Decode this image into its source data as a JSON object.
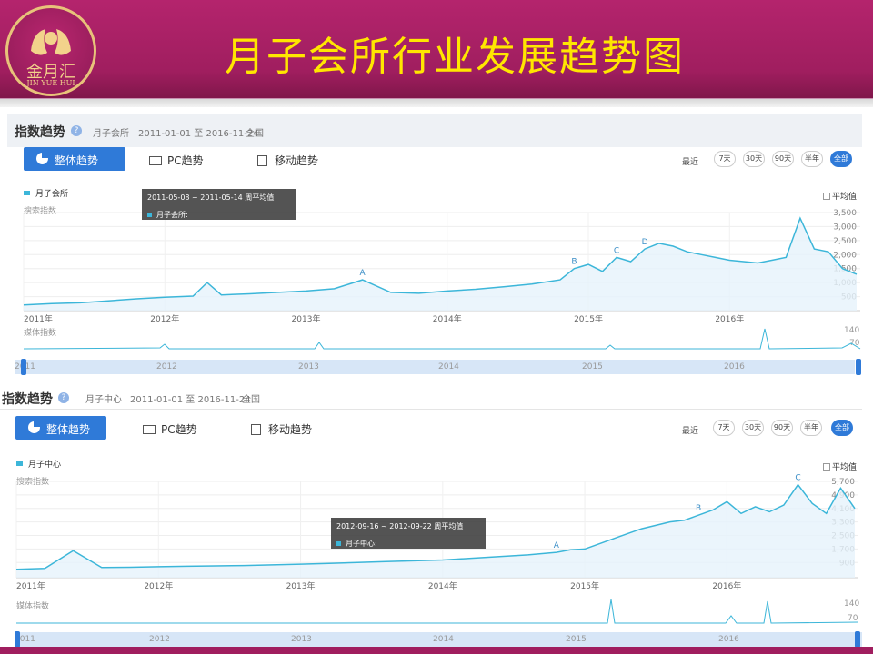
{
  "header": {
    "title": "月子会所行业发展趋势图",
    "logo_text": "金月汇",
    "logo_sub": "JIN YUE HUI"
  },
  "colors": {
    "header": "#a01e5f",
    "title": "#ffe600",
    "line": "#3cb6d9",
    "fill": "#e6f3fb",
    "accent": "#2f7ad8"
  },
  "panels": [
    {
      "section_title": "指数趋势",
      "keyword": "月子会所",
      "date_range": "2011-01-01 至 2016-11-24",
      "region": "全国",
      "tabs": {
        "overall": "整体趋势",
        "pc": "PC趋势",
        "mobile": "移动趋势"
      },
      "range_label": "最近",
      "range_buttons": [
        "7天",
        "30天",
        "90天",
        "半年",
        "全部"
      ],
      "legend": "月子会所",
      "avg_label": "平均值",
      "search_label": "搜索指数",
      "media_label": "媒体指数",
      "tooltip_date": "2011-05-08 ~ 2011-05-14 周平均值",
      "tooltip_series": "月子会所:",
      "media_ticks": [
        "140",
        "70"
      ],
      "slider_years": [
        "2011",
        "2012",
        "2013",
        "2014",
        "2015",
        "2016"
      ]
    },
    {
      "section_title": "指数趋势",
      "keyword": "月子中心",
      "date_range": "2011-01-01 至 2016-11-24",
      "region": "全国",
      "tabs": {
        "overall": "整体趋势",
        "pc": "PC趋势",
        "mobile": "移动趋势"
      },
      "range_label": "最近",
      "range_buttons": [
        "7天",
        "30天",
        "90天",
        "半年",
        "全部"
      ],
      "legend": "月子中心",
      "avg_label": "平均值",
      "search_label": "搜索指数",
      "media_label": "媒体指数",
      "tooltip_date": "2012-09-16 ~ 2012-09-22 周平均值",
      "tooltip_series": "月子中心:",
      "media_ticks": [
        "140",
        "70"
      ],
      "slider_years": [
        "2011",
        "2012",
        "2013",
        "2014",
        "2015",
        "2016"
      ]
    }
  ],
  "chart_data": [
    {
      "type": "line",
      "series": [
        {
          "name": "月子会所",
          "x": [
            2011.0,
            2011.2,
            2011.4,
            2011.6,
            2011.8,
            2012.0,
            2012.2,
            2012.3,
            2012.4,
            2012.6,
            2012.8,
            2013.0,
            2013.2,
            2013.4,
            2013.6,
            2013.8,
            2014.0,
            2014.2,
            2014.4,
            2014.6,
            2014.8,
            2014.9,
            2015.0,
            2015.1,
            2015.2,
            2015.3,
            2015.4,
            2015.5,
            2015.6,
            2015.7,
            2015.8,
            2015.9,
            2016.0,
            2016.1,
            2016.2,
            2016.3,
            2016.4,
            2016.5,
            2016.6,
            2016.7,
            2016.8,
            2016.9
          ],
          "y": [
            200,
            250,
            280,
            350,
            420,
            480,
            520,
            1000,
            560,
            600,
            650,
            700,
            780,
            1100,
            650,
            620,
            700,
            760,
            850,
            950,
            1100,
            1500,
            1650,
            1400,
            1900,
            1750,
            2200,
            2400,
            2300,
            2100,
            2000,
            1900,
            1800,
            1750,
            1700,
            1800,
            1900,
            3300,
            2200,
            2100,
            1500,
            1300
          ]
        }
      ],
      "annotations": [
        "A",
        "B",
        "C",
        "D"
      ],
      "x_ticks": [
        "2011年",
        "2012年",
        "2013年",
        "2014年",
        "2015年",
        "2016年"
      ],
      "y_ticks": [
        "500",
        "1,000",
        "1,500",
        "2,000",
        "2,500",
        "3,000",
        "3,500"
      ],
      "ylim": [
        0,
        3500
      ]
    },
    {
      "type": "line",
      "series": [
        {
          "name": "月子中心",
          "x": [
            2011.0,
            2011.2,
            2011.4,
            2011.6,
            2011.8,
            2012.0,
            2012.2,
            2012.4,
            2012.6,
            2012.8,
            2013.0,
            2013.2,
            2013.4,
            2013.6,
            2013.8,
            2014.0,
            2014.2,
            2014.4,
            2014.6,
            2014.8,
            2014.9,
            2015.0,
            2015.1,
            2015.2,
            2015.3,
            2015.4,
            2015.5,
            2015.6,
            2015.7,
            2015.8,
            2015.9,
            2016.0,
            2016.1,
            2016.2,
            2016.3,
            2016.4,
            2016.5,
            2016.6,
            2016.7,
            2016.8,
            2016.9
          ],
          "y": [
            500,
            550,
            1600,
            600,
            620,
            650,
            680,
            700,
            720,
            760,
            800,
            850,
            900,
            950,
            1000,
            1050,
            1150,
            1250,
            1350,
            1500,
            1650,
            1700,
            2000,
            2300,
            2600,
            2900,
            3100,
            3300,
            3400,
            3700,
            4000,
            4500,
            3800,
            4200,
            3900,
            4300,
            5500,
            4400,
            3800,
            5300,
            4100
          ]
        }
      ],
      "annotations": [
        "A",
        "B",
        "C"
      ],
      "x_ticks": [
        "2011年",
        "2012年",
        "2013年",
        "2014年",
        "2015年",
        "2016年"
      ],
      "y_ticks": [
        "900",
        "1,700",
        "2,500",
        "3,300",
        "4,100",
        "4,900",
        "5,700"
      ],
      "ylim": [
        0,
        5700
      ]
    }
  ]
}
